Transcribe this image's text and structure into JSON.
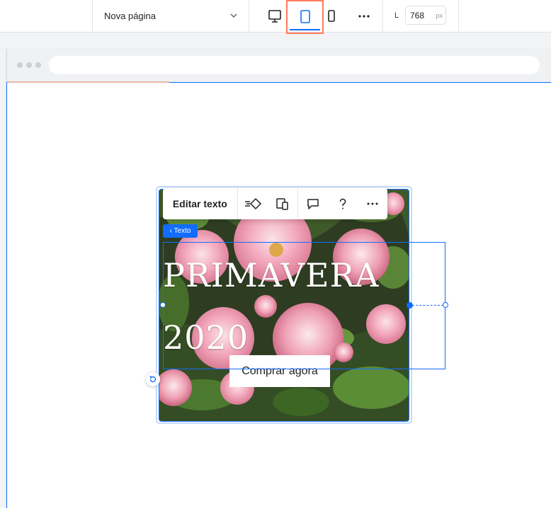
{
  "topbar": {
    "page_name": "Nova página",
    "width_label": "L",
    "width_value": "768",
    "width_unit": "px",
    "devices": [
      "desktop",
      "tablet",
      "mobile"
    ],
    "active_device": "tablet"
  },
  "hero": {
    "title_line1": "PRIMAVERA",
    "title_line2": "2020",
    "cta_label": "Comprar agora"
  },
  "floating_toolbar": {
    "edit_label": "Editar texto"
  },
  "selection_tag": "‹ Texto",
  "colors": {
    "accent": "#116dff",
    "active_outline": "#ff7a5c"
  }
}
